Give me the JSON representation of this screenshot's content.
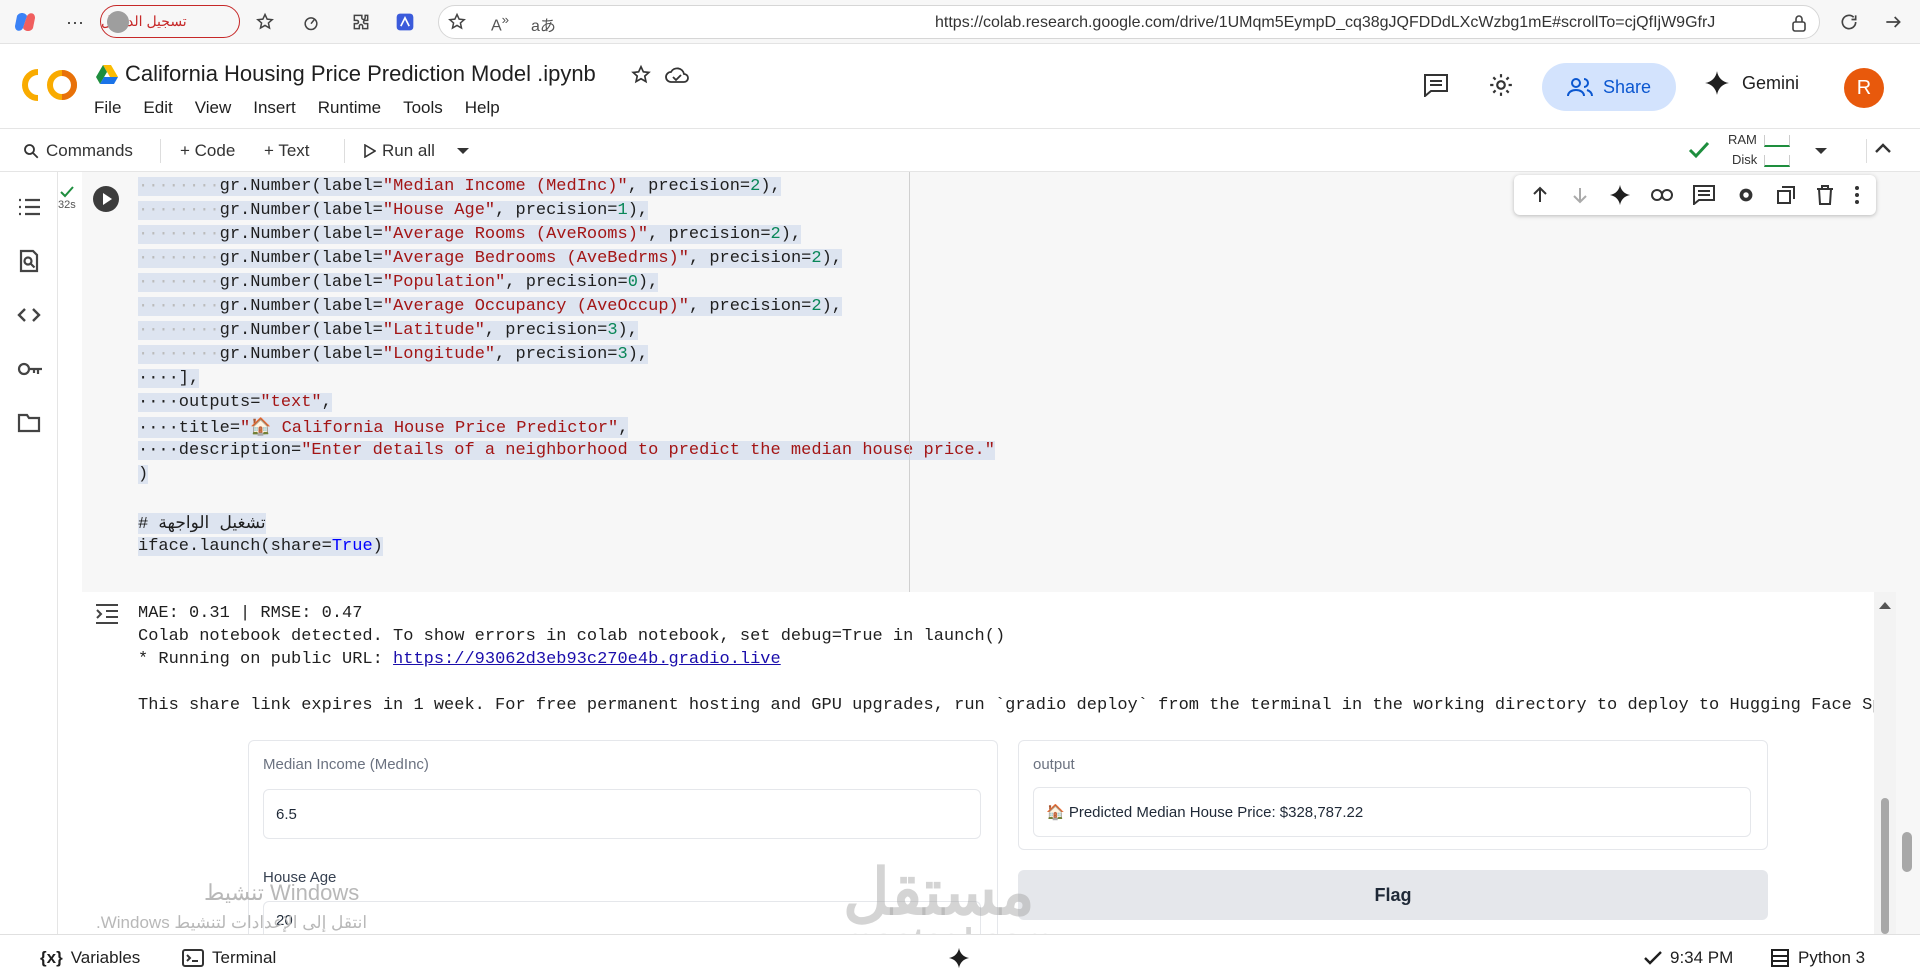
{
  "browser": {
    "signin_label": "تسجيل الدخول",
    "url": "https://colab.research.google.com/drive/1UMqm5EympD_cq38gJQFDDdLXcWzbg1mE#scrollTo=cjQfIjW9GfrJ"
  },
  "header": {
    "logo_text": "CO",
    "title": "California Housing Price Prediction Model .ipynb",
    "share_label": "Share",
    "gemini_label": "Gemini",
    "avatar_letter": "R",
    "menu": [
      "File",
      "Edit",
      "View",
      "Insert",
      "Runtime",
      "Tools",
      "Help"
    ]
  },
  "toolbar": {
    "commands": "Commands",
    "code": "+ Code",
    "text": "+ Text",
    "run_all": "Run all",
    "ram": "RAM",
    "disk": "Disk"
  },
  "cell": {
    "exec_time": "32s"
  },
  "code_lines": [
    {
      "indent": "········",
      "name": "gr.Number",
      "label": "\"Median Income (MedInc)\"",
      "prec": "2"
    },
    {
      "indent": "········",
      "name": "gr.Number",
      "label": "\"House Age\"",
      "prec": "1"
    },
    {
      "indent": "········",
      "name": "gr.Number",
      "label": "\"Average Rooms (AveRooms)\"",
      "prec": "2"
    },
    {
      "indent": "········",
      "name": "gr.Number",
      "label": "\"Average Bedrooms (AveBedrms)\"",
      "prec": "2"
    },
    {
      "indent": "········",
      "name": "gr.Number",
      "label": "\"Population\"",
      "prec": "0"
    },
    {
      "indent": "········",
      "name": "gr.Number",
      "label": "\"Average Occupancy (AveOccup)\"",
      "prec": "2"
    },
    {
      "indent": "········",
      "name": "gr.Number",
      "label": "\"Latitude\"",
      "prec": "3"
    },
    {
      "indent": "········",
      "name": "gr.Number",
      "label": "\"Longitude\"",
      "prec": "3"
    }
  ],
  "code_tail": {
    "bracket_close": "····],",
    "outputs_key": "····outputs=",
    "outputs_val": "\"text\"",
    "title_key": "····title=",
    "title_val": "\"🏠 California House Price Predictor\"",
    "desc_key": "····description=",
    "desc_val": "\"Enter details of a neighborhood to predict the median house price.\"",
    "paren_close": ")",
    "comment": "# تشغيل الواجهة",
    "launch_pre": "iface.launch(share=",
    "launch_true": "True",
    "launch_post": ")"
  },
  "output": {
    "line1": "MAE: 0.31 | RMSE: 0.47",
    "line2": "Colab notebook detected. To show errors in colab notebook, set debug=True in launch()",
    "line3_pre": "* Running on public URL: ",
    "line3_link": "https://93062d3eb93c270e4b.gradio.live",
    "line4": "This share link expires in 1 week. For free permanent hosting and GPU upgrades, run `gradio deploy` from the terminal in the working directory to deploy to Hugging Face Spaces (https:"
  },
  "gradio": {
    "medinc_label": "Median Income (MedInc)",
    "medinc_value": "6.5",
    "houseage_label": "House Age",
    "houseage_value": "20",
    "output_label": "output",
    "output_value": "🏠 Predicted Median House Price: $328,787.22",
    "flag_label": "Flag"
  },
  "watermark": {
    "windows_title": "تنشيط Windows",
    "windows_sub": "انتقل إلى الإعدادات لتنشيط Windows.",
    "mostaql_ar": "مستقل",
    "mostaql_en": "mostaql.com"
  },
  "status": {
    "variables": "Variables",
    "terminal": "Terminal",
    "time": "9:34 PM",
    "runtime": "Python 3"
  },
  "colors": {
    "accent": "#0b57d0",
    "share_bg": "#d3e3fd",
    "avatar": "#e8590c",
    "success": "#1e8e3e",
    "string": "#a31515",
    "number": "#098658",
    "keyword": "#0000ff",
    "comment": "#008000"
  }
}
